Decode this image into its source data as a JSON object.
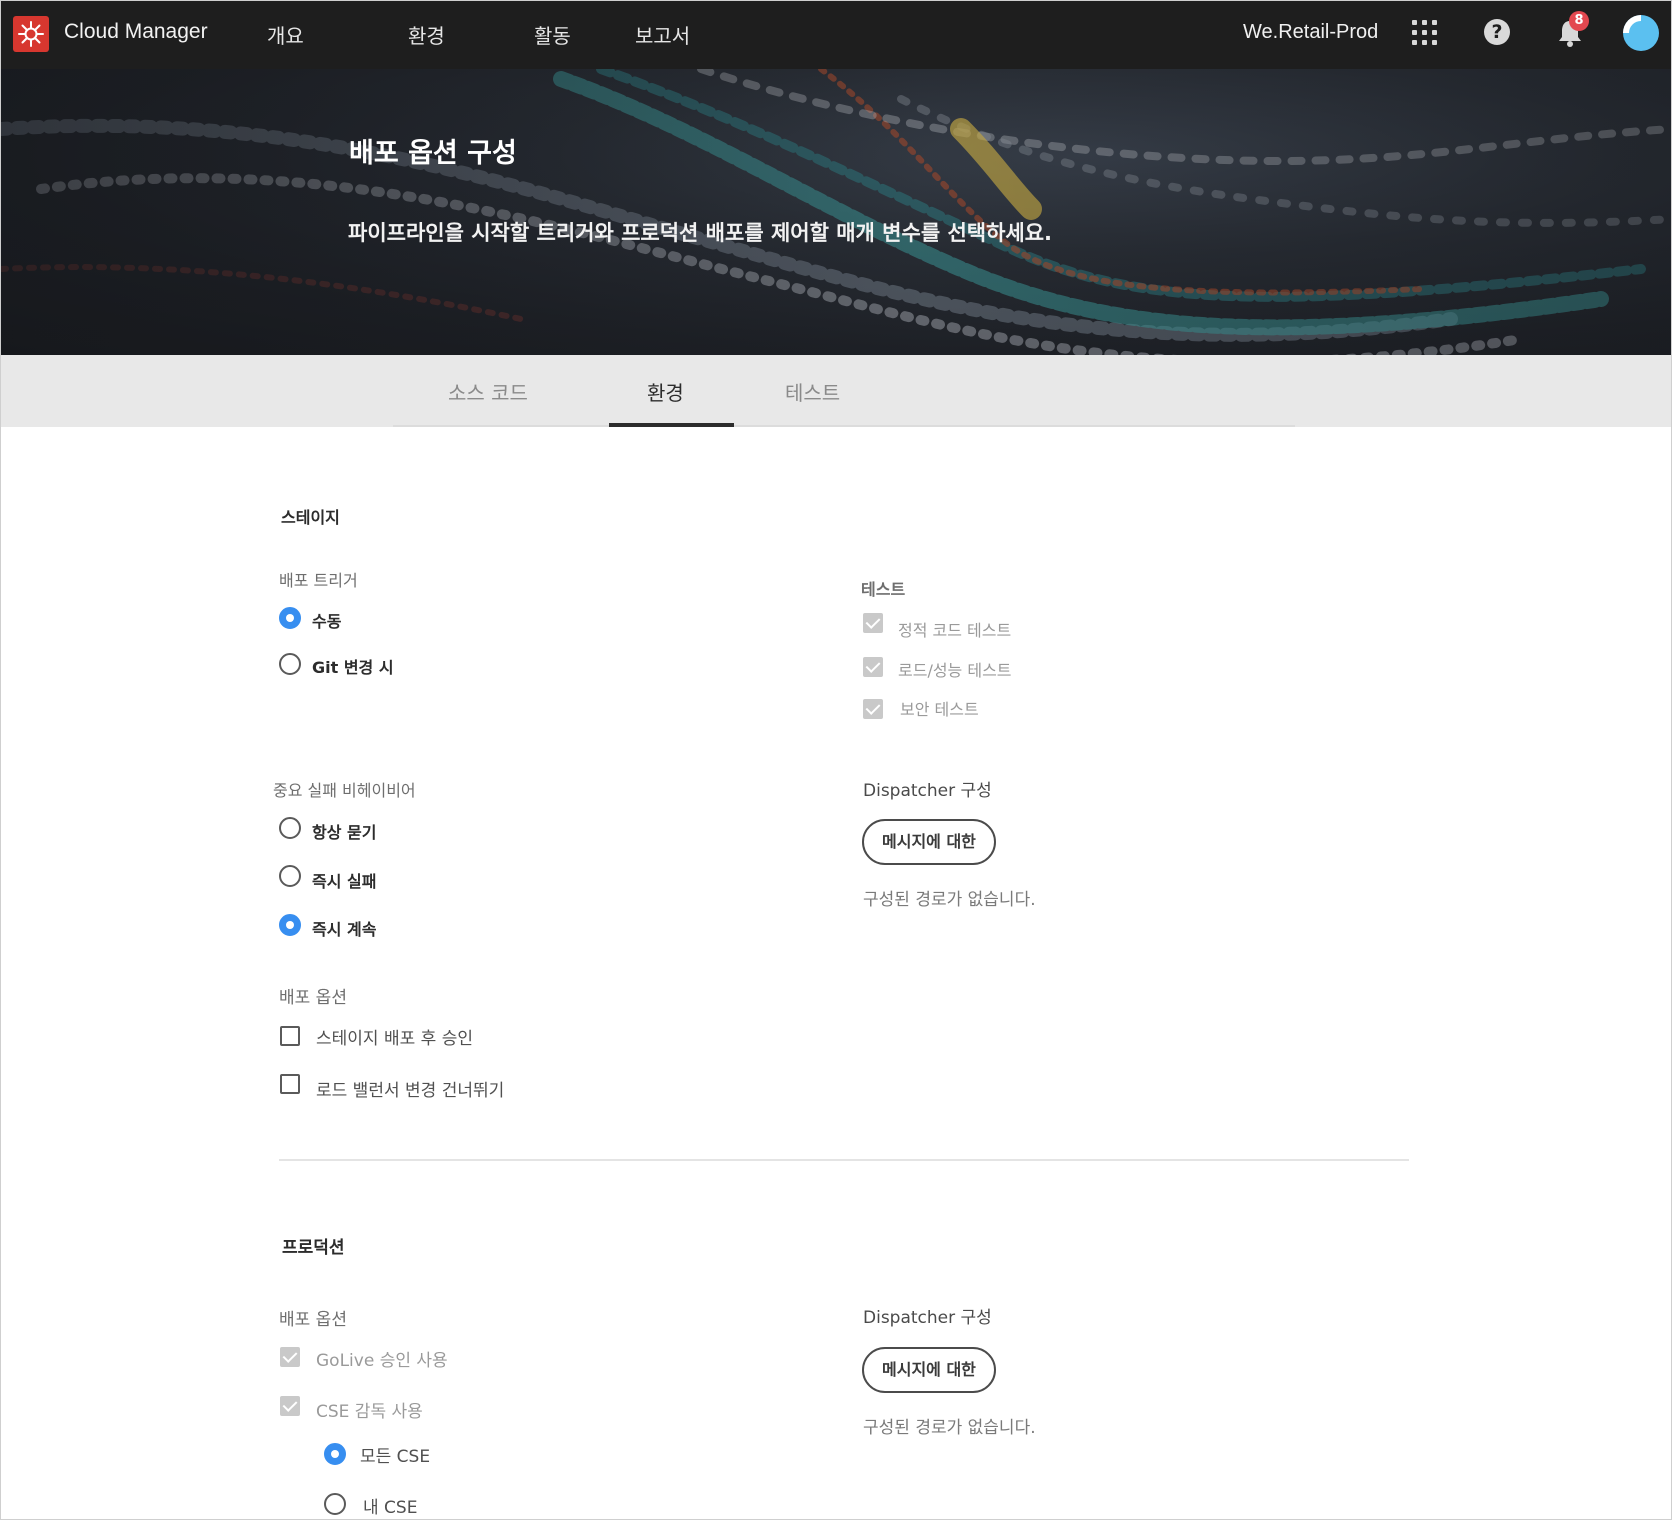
{
  "app": {
    "title": "Cloud Manager",
    "brand_color": "#d7372f"
  },
  "nav": {
    "items": [
      {
        "label": "개요"
      },
      {
        "label": "환경"
      },
      {
        "label": "활동"
      },
      {
        "label": "보고서"
      }
    ],
    "org": "We.Retail-Prod",
    "notification_count": "8",
    "icons": [
      "apps-grid-icon",
      "help-icon",
      "bell-icon",
      "avatar"
    ]
  },
  "hero": {
    "title": "배포 옵션 구성",
    "subtitle": "파이프라인을 시작할 트리거와 프로덕션 배포를 제어할 매개 변수를 선택하세요."
  },
  "tabs": [
    {
      "label": "소스 코드",
      "active": false
    },
    {
      "label": "환경",
      "active": true
    },
    {
      "label": "테스트",
      "active": false
    }
  ],
  "stage": {
    "title": "스테이지",
    "trigger": {
      "label": "배포 트리거",
      "options": [
        {
          "label": "수동",
          "selected": true
        },
        {
          "label": "Git 변경 시",
          "selected": false
        }
      ]
    },
    "tests": {
      "label": "테스트",
      "items": [
        {
          "label": "정적 코드 테스트",
          "checked": true,
          "disabled": true
        },
        {
          "label": "로드/성능 테스트",
          "checked": true,
          "disabled": true
        },
        {
          "label": "보안 테스트",
          "checked": true,
          "disabled": true
        }
      ]
    },
    "failure": {
      "label": "중요 실패 비헤이비어",
      "options": [
        {
          "label": "항상 묻기",
          "selected": false
        },
        {
          "label": "즉시 실패",
          "selected": false
        },
        {
          "label": "즉시 계속",
          "selected": true
        }
      ]
    },
    "dispatcher": {
      "label": "Dispatcher 구성",
      "button": "메시지에 대한",
      "note": "구성된 경로가 없습니다."
    },
    "deploy_options": {
      "label": "배포 옵션",
      "items": [
        {
          "label": "스테이지 배포 후 승인",
          "checked": false
        },
        {
          "label": "로드 밸런서 변경 건너뛰기",
          "checked": false
        }
      ]
    }
  },
  "production": {
    "title": "프로덕션",
    "deploy_options": {
      "label": "배포 옵션",
      "items": [
        {
          "label": "GoLive 승인 사용",
          "checked": true,
          "disabled": true
        },
        {
          "label": "CSE 감독 사용",
          "checked": true,
          "disabled": true
        }
      ],
      "cse_options": [
        {
          "label": "모든 CSE",
          "selected": true
        },
        {
          "label": "내 CSE",
          "selected": false
        }
      ]
    },
    "dispatcher": {
      "label": "Dispatcher 구성",
      "button": "메시지에 대한",
      "note": "구성된 경로가 없습니다."
    }
  },
  "colors": {
    "accent": "#378ef0",
    "topbar": "#1e1e1e",
    "tabbar": "#e8e8e8"
  }
}
